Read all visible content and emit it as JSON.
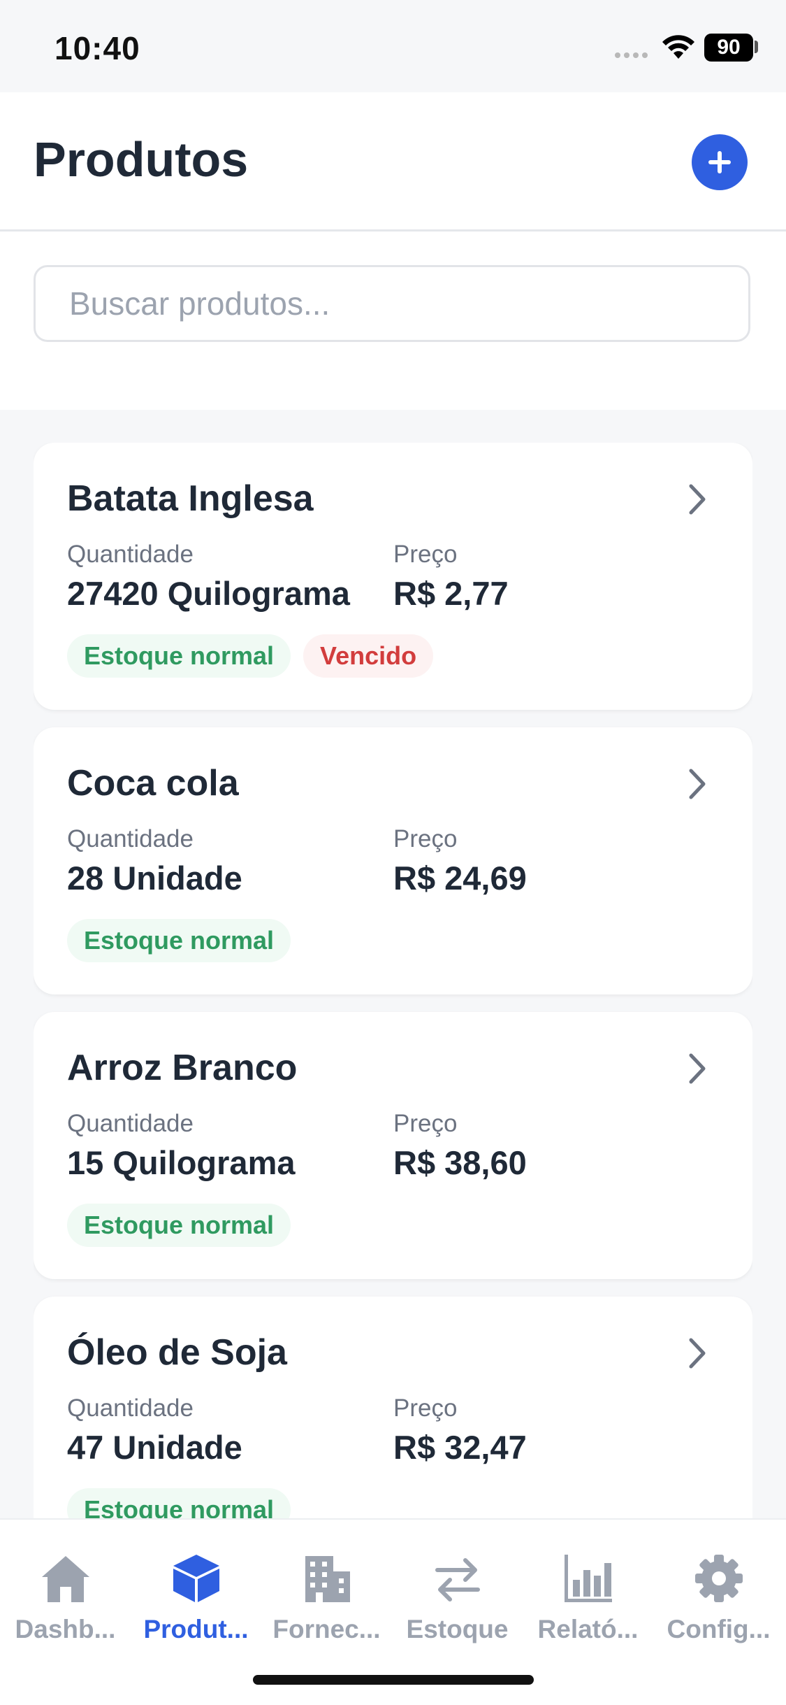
{
  "status_bar": {
    "time": "10:40",
    "battery": "90"
  },
  "header": {
    "title": "Produtos",
    "add_icon": "plus-icon"
  },
  "search": {
    "placeholder": "Buscar produtos...",
    "value": ""
  },
  "labels": {
    "quantity": "Quantidade",
    "price": "Preço"
  },
  "products": [
    {
      "name": "Batata Inglesa",
      "quantity": "27420 Quilograma",
      "price": "R$ 2,77",
      "badges": [
        "Estoque normal",
        "Vencido"
      ]
    },
    {
      "name": "Coca cola",
      "quantity": "28 Unidade",
      "price": "R$ 24,69",
      "badges": [
        "Estoque normal"
      ]
    },
    {
      "name": "Arroz Branco",
      "quantity": "15 Quilograma",
      "price": "R$ 38,60",
      "badges": [
        "Estoque normal"
      ]
    },
    {
      "name": "Óleo de Soja",
      "quantity": "47 Unidade",
      "price": "R$ 32,47",
      "badges": [
        "Estoque normal"
      ]
    }
  ],
  "tabs": [
    {
      "label": "Dashb...",
      "icon": "home-icon"
    },
    {
      "label": "Produt...",
      "icon": "cube-icon",
      "active": true
    },
    {
      "label": "Fornec...",
      "icon": "building-icon"
    },
    {
      "label": "Estoque",
      "icon": "swap-arrows-icon"
    },
    {
      "label": "Relató...",
      "icon": "bar-chart-icon"
    },
    {
      "label": "Config...",
      "icon": "gear-icon"
    }
  ],
  "colors": {
    "accent": "#2f5fe0",
    "ok": "#2f9a60",
    "danger": "#d23d3d",
    "inactive": "#9ca3af"
  }
}
